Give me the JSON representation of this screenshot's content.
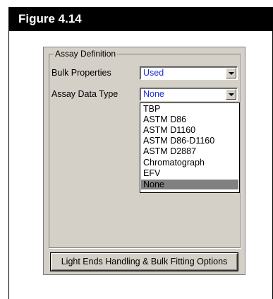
{
  "figure": {
    "title": "Figure 4.14"
  },
  "group": {
    "legend": "Assay Definition"
  },
  "bulk_properties": {
    "label": "Bulk Properties",
    "value": "Used"
  },
  "assay_data_type": {
    "label": "Assay Data Type",
    "value": "None",
    "options": [
      "TBP",
      "ASTM D86",
      "ASTM D1160",
      "ASTM D86-D1160",
      "ASTM D2887",
      "Chromatograph",
      "EFV",
      "None"
    ],
    "selected_index": 7
  },
  "button": {
    "label": "Light Ends Handling & Bulk Fitting Options"
  },
  "colors": {
    "value_text": "#1a2ed8",
    "panel": "#d4d0c8",
    "highlight": "#808080"
  },
  "icons": {
    "combo_arrow": "chevron-down-icon"
  }
}
